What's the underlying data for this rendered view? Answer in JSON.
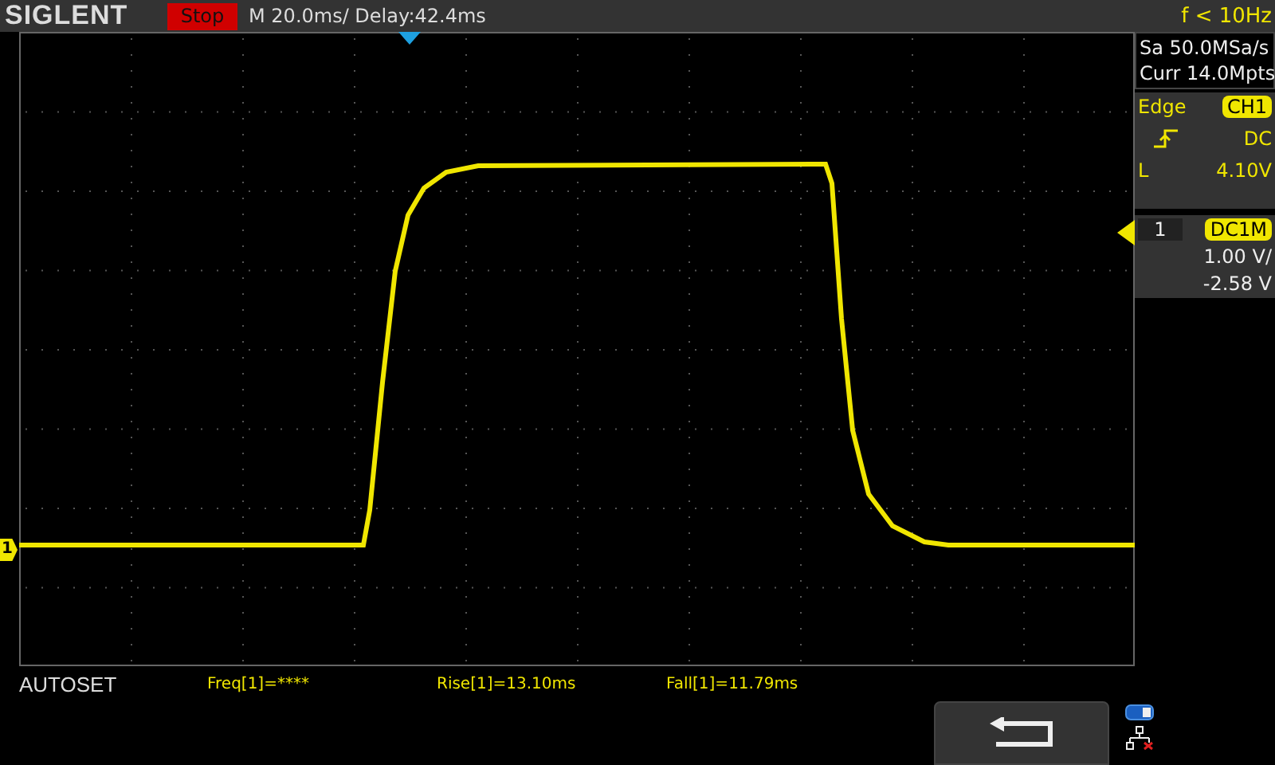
{
  "top_bar": {
    "logo": "SIGLENT",
    "run_state": "Stop",
    "timebase": "M 20.0ms/ Delay:42.4ms",
    "trigger_frequency": "f < 10Hz"
  },
  "acquisition": {
    "sample_rate": "Sa 50.0MSa/s",
    "memory_depth": "Curr 14.0Mpts"
  },
  "trigger": {
    "type": "Edge",
    "source": "CH1",
    "coupling": "DC",
    "level_label": "L",
    "level": "4.10V"
  },
  "channel": {
    "number": "1",
    "coupling": "DC1M",
    "scale": "1.00 V/",
    "offset": "-2.58 V",
    "marker": "1"
  },
  "status_text": "AUTOSET",
  "measurements": [
    "Freq[1]=****",
    "Rise[1]=13.10ms",
    "Fall[1]=11.79ms"
  ]
}
